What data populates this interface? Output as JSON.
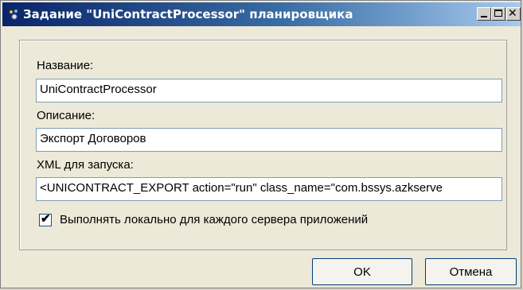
{
  "window": {
    "title": "Задание \"UniContractProcessor\" планировщика"
  },
  "form": {
    "name_label": "Название:",
    "name_value": "UniContractProcessor",
    "description_label": "Описание:",
    "description_value": "Экспорт Договоров",
    "xml_label": "XML для запуска:",
    "xml_value": "<UNICONTRACT_EXPORT action=\"run\" class_name=\"com.bssys.azkserve",
    "local_checkbox_label": "Выполнять локально для каждого сервера приложений",
    "local_checkbox_checked": true
  },
  "buttons": {
    "ok_label": "OK",
    "cancel_label": "Отмена"
  },
  "icons": {
    "title_icon": "scheduler-icon",
    "minimize": "minimize-icon",
    "maximize": "maximize-icon",
    "close": "close-icon"
  }
}
